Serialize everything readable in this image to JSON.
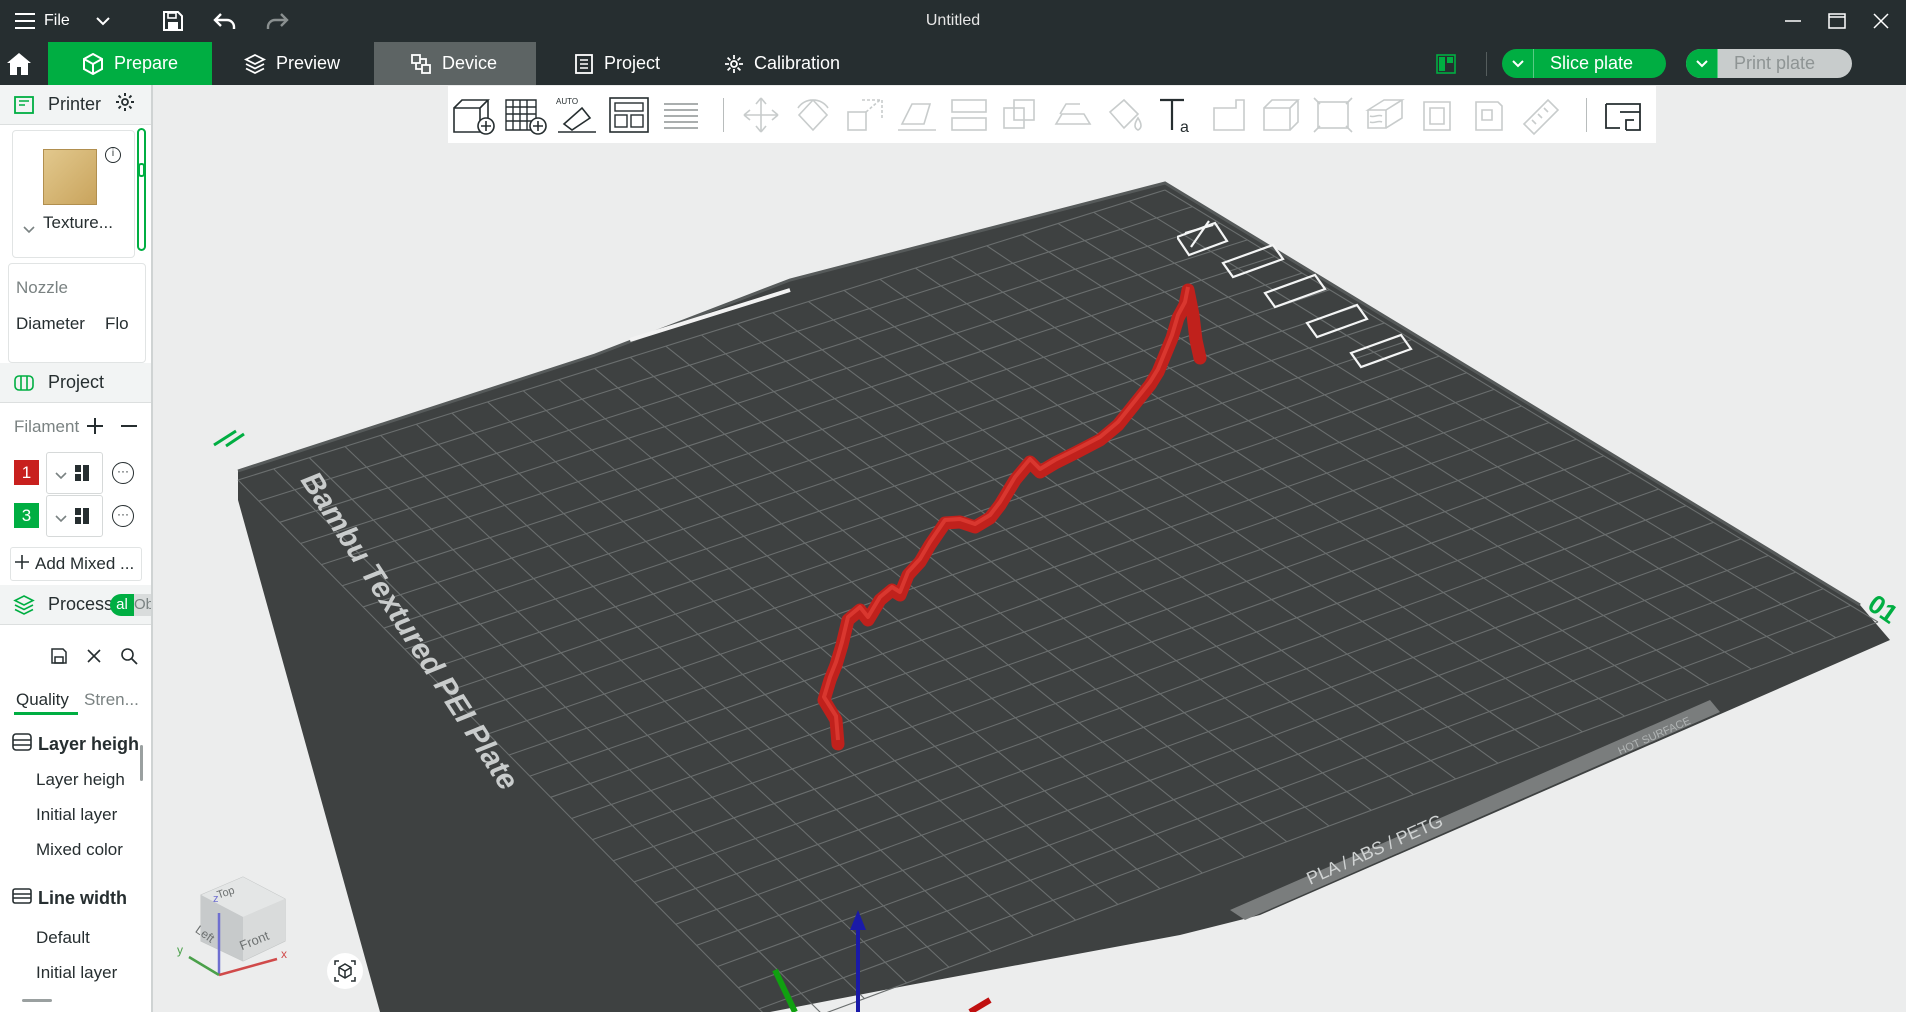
{
  "window": {
    "file_menu_label": "File",
    "title": "Untitled"
  },
  "tabs": [
    {
      "label": "Prepare",
      "state": "active"
    },
    {
      "label": "Preview",
      "state": "normal"
    },
    {
      "label": "Device",
      "state": "hovered"
    },
    {
      "label": "Project",
      "state": "normal"
    },
    {
      "label": "Calibration",
      "state": "normal"
    }
  ],
  "actions": {
    "slice_label": "Slice plate",
    "print_label": "Print plate",
    "print_enabled": false
  },
  "sidebar": {
    "printer": {
      "title": "Printer",
      "plate_label": "Texture...",
      "nozzle_title": "Nozzle",
      "nozzle_diameter_label": "Diameter",
      "nozzle_flow_label": "Flo"
    },
    "project": {
      "title": "Project",
      "filament_label": "Filament",
      "filaments": [
        {
          "index": "1",
          "color": "#c8201e"
        },
        {
          "index": "3",
          "color": "#00ae42"
        }
      ],
      "add_mixed_label": "Add Mixed ..."
    },
    "process": {
      "title": "Process",
      "toggle_global_label": "al",
      "toggle_object_label": "Ob",
      "subtabs": [
        {
          "label": "Quality",
          "active": true
        },
        {
          "label": "Stren...",
          "active": false
        }
      ],
      "groups": [
        {
          "title": "Layer heigh",
          "items": [
            "Layer heigh",
            "Initial layer",
            "Mixed color"
          ]
        },
        {
          "title": "Line width",
          "items": [
            "Default",
            "Initial layer"
          ]
        }
      ]
    }
  },
  "viewport": {
    "plate_name": "Bambu Textured PEI Plate",
    "plate_materials": "PLA / ABS / PETG",
    "plate_warning": "HOT SURFACE",
    "plate_number": "01",
    "view_cube": {
      "top": "Top",
      "left": "Left",
      "front": "Front"
    },
    "axes": {
      "x": "x",
      "y": "y",
      "z": "z"
    },
    "model_color": "#c0211c",
    "accent_color": "#00ae42"
  }
}
